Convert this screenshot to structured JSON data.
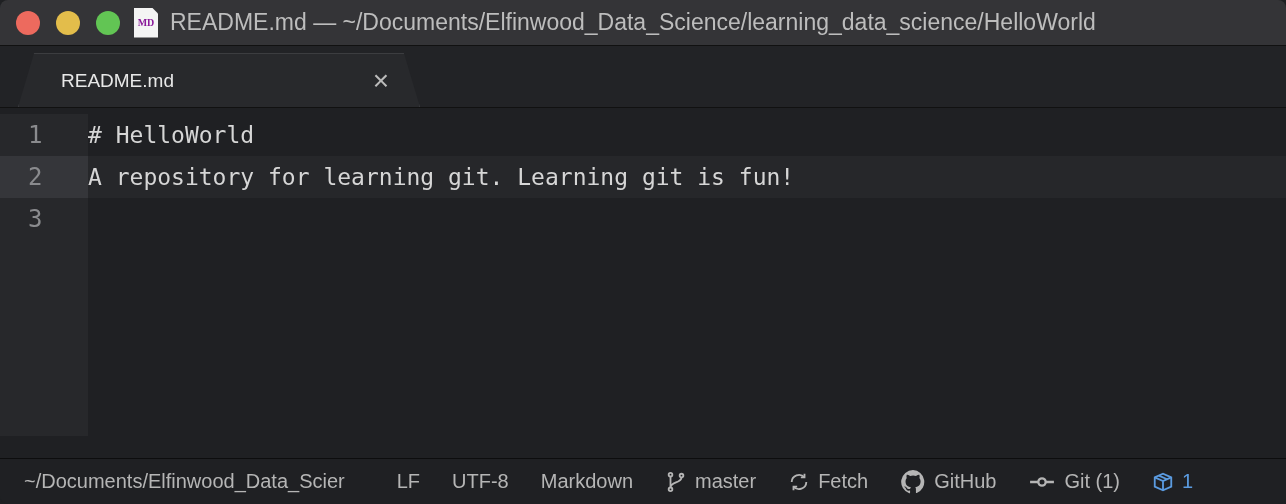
{
  "window": {
    "title": "README.md — ~/Documents/Elfinwood_Data_Science/learning_data_science/HelloWorld",
    "file_badge": "MD"
  },
  "tabs": [
    {
      "label": "README.md",
      "selected": true,
      "close": "×"
    }
  ],
  "editor": {
    "lines": [
      {
        "number": "1",
        "text": "# HelloWorld",
        "current": false
      },
      {
        "number": "2",
        "text": "A repository for learning git. Learning git is fun!",
        "current": true
      },
      {
        "number": "3",
        "current": false
      }
    ]
  },
  "status_bar": {
    "path": "~/Documents/Elfinwood_Data_Scier",
    "items": [
      {
        "kind": "text",
        "label": "LF"
      },
      {
        "kind": "text",
        "label": "UTF-8"
      },
      {
        "kind": "text",
        "label": "Markdown"
      },
      {
        "kind": "branch",
        "label": "master"
      },
      {
        "kind": "fetch",
        "label": "Fetch"
      },
      {
        "kind": "github",
        "label": "GitHub"
      },
      {
        "kind": "git",
        "label": "Git (1)"
      },
      {
        "kind": "package",
        "label": "1"
      }
    ]
  }
}
